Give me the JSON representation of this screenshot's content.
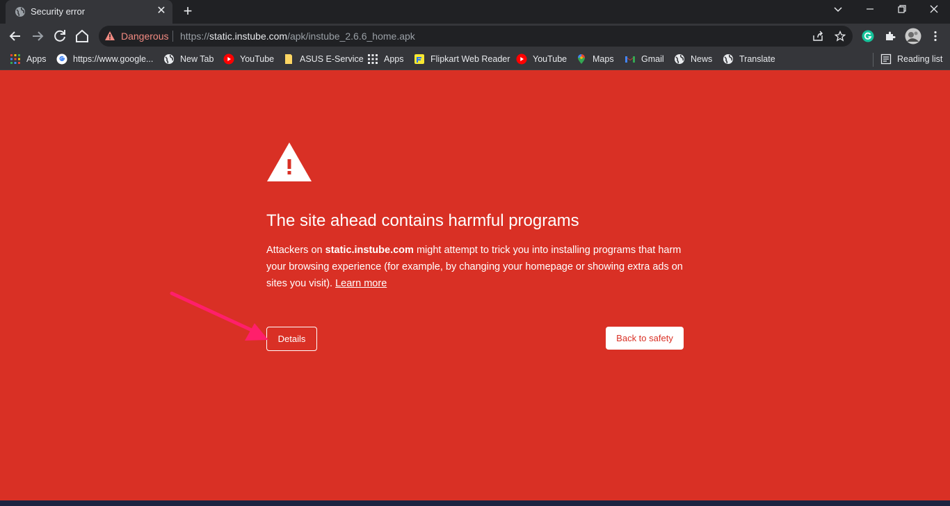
{
  "tab": {
    "title": "Security error",
    "close": "✕"
  },
  "new_tab": "+",
  "window": {
    "dropdown": "⌄",
    "minimize": "—",
    "restore": "❐",
    "close": "✕"
  },
  "omnibox": {
    "security_label": "Dangerous",
    "url_scheme": "https://",
    "url_host": "static.instube.com",
    "url_path": "/apk/instube_2.6.6_home.apk"
  },
  "bookmarks": [
    {
      "label": "Apps",
      "icon": "apps-grid-icon"
    },
    {
      "label": "https://www.google...",
      "icon": "google-icon"
    },
    {
      "label": "New Tab",
      "icon": "globe-icon"
    },
    {
      "label": "YouTube",
      "icon": "youtube-icon"
    },
    {
      "label": "ASUS E-Service",
      "icon": "folder-icon"
    },
    {
      "label": "Apps",
      "icon": "apps-grid-icon"
    },
    {
      "label": "Flipkart Web Reader",
      "icon": "flipkart-icon"
    },
    {
      "label": "YouTube",
      "icon": "youtube-icon"
    },
    {
      "label": "Maps",
      "icon": "maps-icon"
    },
    {
      "label": "Gmail",
      "icon": "gmail-icon"
    },
    {
      "label": "News",
      "icon": "globe-icon"
    },
    {
      "label": "Translate",
      "icon": "globe-icon"
    }
  ],
  "reading_list": "Reading list",
  "interstitial": {
    "heading": "The site ahead contains harmful programs",
    "para_prefix": "Attackers on ",
    "para_host": "static.instube.com",
    "para_suffix": " might attempt to trick you into installing programs that harm your browsing experience (for example, by changing your homepage or showing extra ads on sites you visit). ",
    "learn_more": "Learn more",
    "details_button": "Details",
    "back_button": "Back to safety"
  },
  "colors": {
    "page_background": "#d93025",
    "danger_text": "#f28b82",
    "annotation_arrow": "#ff1f6b",
    "chrome_dark": "#202124",
    "chrome_toolbar": "#35363a"
  }
}
